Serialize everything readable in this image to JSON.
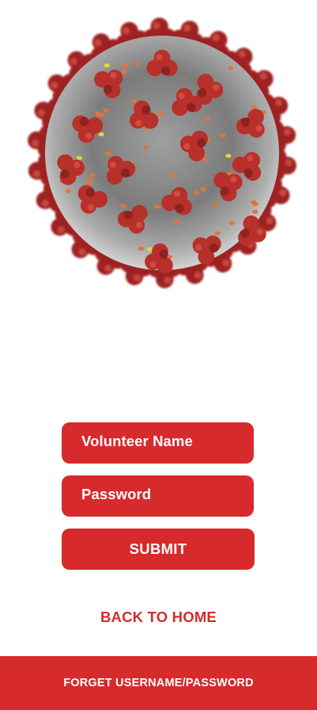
{
  "image": {
    "icon": "coronavirus-illustration"
  },
  "form": {
    "name_placeholder": "Volunteer Name",
    "password_placeholder": "Password",
    "submit_label": "SUBMIT"
  },
  "links": {
    "back_to_home": "BACK TO HOME"
  },
  "footer": {
    "forgot_label": "FORGET USERNAME/PASSWORD"
  },
  "colors": {
    "accent": "#d72a2c",
    "background": "#ffffff",
    "text_on_accent": "#ffffff"
  }
}
